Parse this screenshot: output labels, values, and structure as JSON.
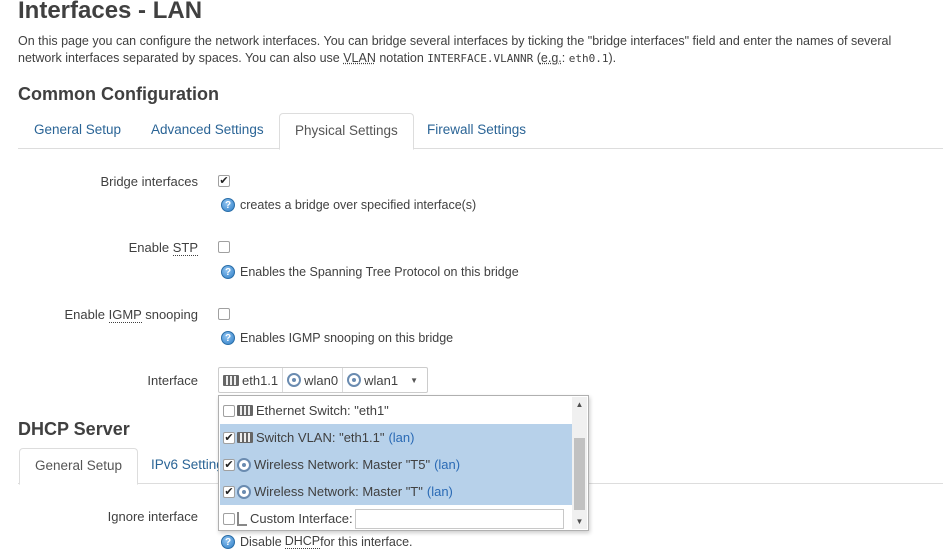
{
  "page": {
    "title": "Interfaces - LAN",
    "intro_part1": "On this page you can configure the network interfaces. You can bridge several interfaces by ticking the \"bridge interfaces\" field and enter the names of several network interfaces separated by spaces. You can also use ",
    "intro_vlan": "VLAN",
    "intro_part2": " notation ",
    "intro_code": "INTERFACE.VLANNR",
    "intro_part3": " (",
    "intro_eg": "e.g.",
    "intro_part4": ": ",
    "intro_example": "eth0.1",
    "intro_part5": ")."
  },
  "common": {
    "title": "Common Configuration",
    "tabs": [
      {
        "label": "General Setup"
      },
      {
        "label": "Advanced Settings"
      },
      {
        "label": "Physical Settings"
      },
      {
        "label": "Firewall Settings"
      }
    ],
    "active_tab": "Physical Settings"
  },
  "physical": {
    "bridge": {
      "label": "Bridge interfaces",
      "checked": true,
      "hint": "creates a bridge over specified interface(s)"
    },
    "stp": {
      "label_pre": "Enable ",
      "label_abbr": "STP",
      "checked": false,
      "hint": "Enables the Spanning Tree Protocol on this bridge"
    },
    "igmp": {
      "label_pre": "Enable ",
      "label_abbr": "IGMP",
      "label_post": " snooping",
      "checked": false,
      "hint": "Enables IGMP snooping on this bridge"
    },
    "interface": {
      "label": "Interface",
      "chips": [
        {
          "label": "eth1.1",
          "icon": "switch-icon"
        },
        {
          "label": "wlan0",
          "icon": "wireless-icon"
        },
        {
          "label": "wlan1",
          "icon": "wireless-icon"
        }
      ],
      "options": [
        {
          "text": "Ethernet Switch: \"eth1\"",
          "tag": "",
          "checked": false,
          "icon": "switch-icon"
        },
        {
          "text": "Switch VLAN: \"eth1.1\"",
          "tag": "(lan)",
          "checked": true,
          "icon": "switch-icon"
        },
        {
          "text": "Wireless Network: Master \"T5\"",
          "tag": "(lan)",
          "checked": true,
          "icon": "wireless-icon"
        },
        {
          "text": "Wireless Network: Master \"T\"",
          "tag": "(lan)",
          "checked": true,
          "icon": "wireless-icon"
        },
        {
          "text": "Custom Interface:",
          "tag": "",
          "checked": false,
          "icon": "plug-icon"
        }
      ],
      "custom_value": ""
    }
  },
  "dhcp": {
    "title": "DHCP Server",
    "tabs": [
      {
        "label": "General Setup"
      },
      {
        "label": "IPv6 Settings"
      }
    ],
    "active_tab": "General Setup",
    "ignore": {
      "label": "Ignore interface",
      "hint_pre": "Disable ",
      "hint_abbr": "DHCP",
      "hint_post": " for this interface."
    }
  },
  "colors": {
    "link": "#2a6496",
    "selected_row": "#b7d1ea",
    "lan_tag": "#2a6ab5"
  }
}
